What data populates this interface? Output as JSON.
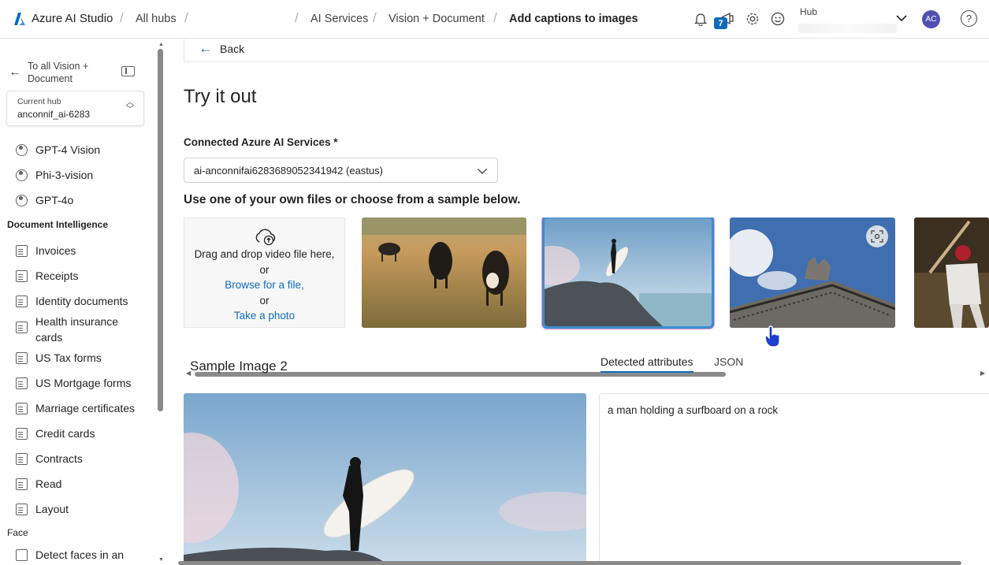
{
  "app": {
    "name": "Azure AI Studio"
  },
  "breadcrumb": {
    "all_hubs": "All hubs",
    "ai_services": "AI Services",
    "vision_document": "Vision + Document",
    "current": "Add captions to images"
  },
  "header": {
    "notification_count": "7",
    "hub_label": "Hub",
    "avatar_initials": "AC",
    "help_glyph": "?"
  },
  "sidebar": {
    "back_label": "To all Vision + Document",
    "current_hub_label": "Current hub",
    "current_hub_value": "anconnif_ai-6283",
    "vision_items": [
      {
        "label": "GPT-4 Vision"
      },
      {
        "label": "Phi-3-vision"
      },
      {
        "label": "GPT-4o"
      }
    ],
    "document_section": "Document Intelligence",
    "document_items": [
      {
        "label": "Invoices"
      },
      {
        "label": "Receipts"
      },
      {
        "label": "Identity documents"
      },
      {
        "label": "Health insurance cards"
      },
      {
        "label": "US Tax forms"
      },
      {
        "label": "US Mortgage forms"
      },
      {
        "label": "Marriage certificates"
      },
      {
        "label": "Credit cards"
      },
      {
        "label": "Contracts"
      },
      {
        "label": "Read"
      },
      {
        "label": "Layout"
      }
    ],
    "face_section": "Face",
    "face_items": [
      {
        "label": "Detect faces in an"
      }
    ]
  },
  "main": {
    "back_label": "Back",
    "title": "Try it out",
    "connected_label": "Connected Azure AI Services *",
    "connected_value": "ai-anconnifai6283689052341942 (eastus)",
    "use_files_text": "Use one of your own files or choose from a sample below.",
    "drop": {
      "line1": "Drag and drop video file here,",
      "or1": "or",
      "browse": "Browse for a file,",
      "or2": "or",
      "take_photo": "Take a photo"
    },
    "sample_title": "Sample Image 2",
    "tabs": [
      {
        "label": "Detected attributes"
      },
      {
        "label": "JSON"
      }
    ],
    "caption": "a man holding a surfboard on a rock"
  },
  "colors": {
    "accent": "#0f6cbd",
    "selected_outline": "#3d8cd0",
    "selected_glow": "#e98fd0",
    "avatar": "#4f52b2"
  }
}
